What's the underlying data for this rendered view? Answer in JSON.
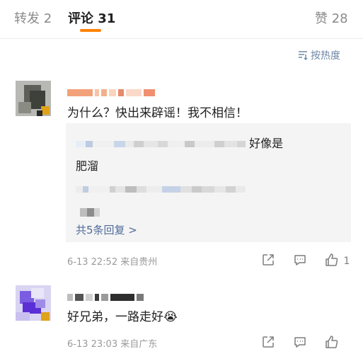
{
  "tabs": [
    {
      "label": "转发",
      "count": "2"
    },
    {
      "label": "评论",
      "count": "31"
    },
    {
      "label": "赞",
      "count": "28"
    }
  ],
  "sort_label": "按热度",
  "comments": [
    {
      "text": "为什么？快出来辟谣！我不相信！",
      "replies": [
        {
          "visible_text": "好像是",
          "second_line": "肥溜"
        }
      ],
      "more_replies_label": "共5条回复 >",
      "time": "6-13 22:52",
      "location": "来自贵州",
      "like_count": "1"
    },
    {
      "text": "好兄弟，一路走好😭",
      "time": "6-13 23:03",
      "location": "来自广东"
    }
  ],
  "colors": {
    "accent": "#ff8200",
    "link": "#506b9a",
    "muted": "#9a9a9a"
  },
  "icons": [
    "sort-icon",
    "share-icon",
    "comment-icon",
    "like-icon"
  ]
}
